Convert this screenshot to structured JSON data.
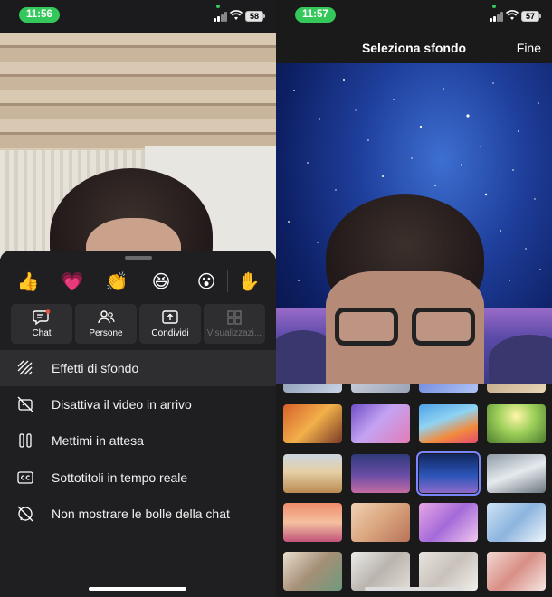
{
  "left_screen": {
    "status": {
      "time": "11:56",
      "battery": "58"
    },
    "reactions": [
      {
        "icon": "thumbs-up-icon",
        "glyph": "👍"
      },
      {
        "icon": "heart-icon",
        "glyph": "💗"
      },
      {
        "icon": "clapping-hands-icon",
        "glyph": "👏"
      },
      {
        "icon": "laughing-face-icon",
        "glyph": "😆"
      },
      {
        "icon": "surprised-face-icon",
        "glyph": "😮"
      },
      {
        "icon": "raised-hand-icon",
        "glyph": "✋"
      }
    ],
    "toolbar": [
      {
        "label": "Chat",
        "icon": "chat-icon"
      },
      {
        "label": "Persone",
        "icon": "people-icon"
      },
      {
        "label": "Condividi",
        "icon": "share-icon"
      },
      {
        "label": "Visualizzazi...",
        "icon": "layout-grid-icon"
      }
    ],
    "menu": [
      {
        "label": "Effetti di sfondo",
        "icon": "background-effects-icon"
      },
      {
        "label": "Disattiva il video in arrivo",
        "icon": "video-off-icon"
      },
      {
        "label": "Mettimi in attesa",
        "icon": "pause-icon"
      },
      {
        "label": "Sottotitoli in tempo reale",
        "icon": "captions-icon"
      },
      {
        "label": "Non mostrare le bolle della chat",
        "icon": "chat-bubbles-off-icon"
      }
    ]
  },
  "right_screen": {
    "status": {
      "time": "11:57",
      "battery": "57"
    },
    "nav": {
      "title": "Seleziona sfondo",
      "done_label": "Fine"
    },
    "selected_background": "starry-sky"
  },
  "colors": {
    "accent_green": "#34c759",
    "selection_outline": "#7a86ff",
    "sheet_bg": "#1f1f21"
  }
}
